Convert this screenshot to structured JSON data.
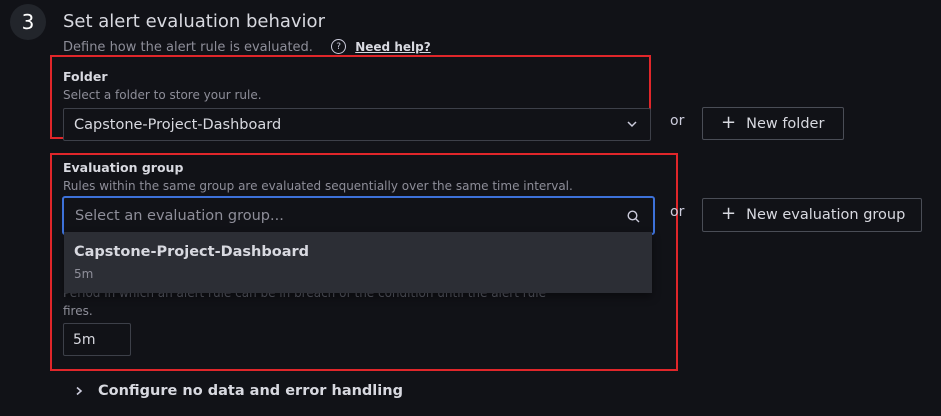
{
  "step": {
    "number": "3",
    "title": "Set alert evaluation behavior",
    "subtitle": "Define how the alert rule is evaluated.",
    "help_link": "Need help?"
  },
  "folder": {
    "label": "Folder",
    "description": "Select a folder to store your rule.",
    "selected": "Capstone-Project-Dashboard",
    "or_text": "or",
    "new_button": "New folder"
  },
  "evaluation_group": {
    "label": "Evaluation group",
    "description": "Rules within the same group are evaluated sequentially over the same time interval.",
    "placeholder": "Select an evaluation group...",
    "or_text": "or",
    "new_button": "New evaluation group",
    "options": [
      {
        "name": "Capstone-Project-Dashboard",
        "interval": "5m"
      }
    ]
  },
  "pending_period": {
    "description": "Period in which an alert rule can be in breach of the condition until the alert rule",
    "description_cont": "fires.",
    "value": "5m"
  },
  "collapsible": {
    "label": "Configure no data and error handling"
  },
  "colors": {
    "highlight_border": "#e0262a",
    "focus_border": "#3d71d9",
    "background": "#111217"
  }
}
